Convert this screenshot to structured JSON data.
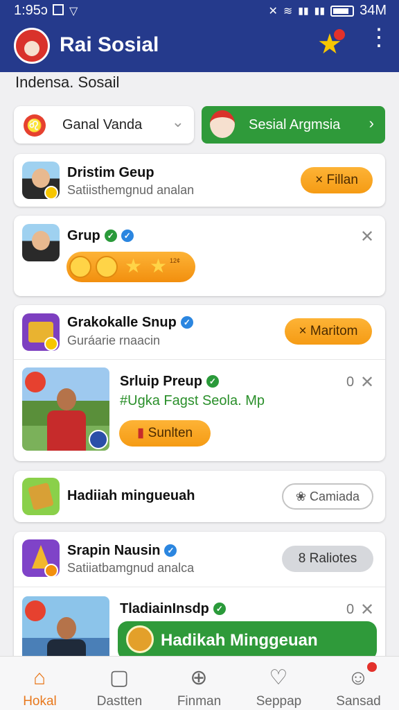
{
  "status_bar": {
    "time": "1:95ɔ",
    "battery": "34M"
  },
  "app_bar": {
    "title": "Rai Sosial"
  },
  "section_label": "Indensa. Sosail",
  "controls": {
    "dropdown_label": "Ganal Vanda",
    "cta_label": "Sesial Argmsia"
  },
  "cards": {
    "c1": {
      "title": "Dristim Geup",
      "subtitle": "Satiisthemgnud analan",
      "button": "Fillan"
    },
    "c2": {
      "title": "Grup",
      "reaction_count": "12¢"
    },
    "c3": {
      "title": "Grakokalle Snup",
      "subtitle": "Guráarie rnaacin",
      "button": "Maritom"
    },
    "c3b": {
      "title": "Srluip Preup",
      "count": "0",
      "hashtag": "#Ugka Fagst Seola. Mp",
      "button": "Sunlten"
    },
    "c4": {
      "title": "Hadiiah mingueuah",
      "button": "Camiada"
    },
    "c5": {
      "title": "Srapin Nausin",
      "subtitle": "Satiiatbamgnud analca",
      "button": "Raliotes"
    },
    "c5b": {
      "title": "TladiainInsdp",
      "count": "0",
      "button": "Hadikah Minggeuan"
    }
  },
  "bottom_nav": [
    {
      "label": "Hokal",
      "icon": "home-icon",
      "active": true
    },
    {
      "label": "Dastten",
      "icon": "square-icon"
    },
    {
      "label": "Finman",
      "icon": "plus-circle-icon"
    },
    {
      "label": "Seppap",
      "icon": "heart-icon"
    },
    {
      "label": "Sansad",
      "icon": "profile-icon"
    }
  ],
  "colors": {
    "primary": "#253a8c",
    "green": "#2f9a3a",
    "orange": "#f59b14",
    "active_nav": "#e8781c"
  }
}
